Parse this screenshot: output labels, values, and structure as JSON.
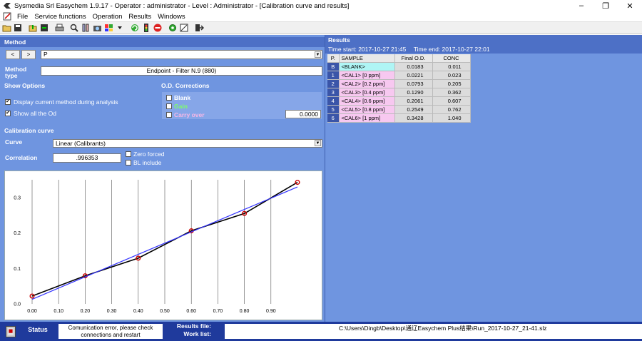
{
  "titlebar": {
    "title": "Sysmedia Srl Easychem 1.9.17 - Operator : administrator - Level : Administrator - [Calibration curve and results]",
    "minimize": "–",
    "maximize": "❐",
    "close": "✕"
  },
  "menubar": {
    "items": [
      "File",
      "Service functions",
      "Operation",
      "Results",
      "Windows"
    ]
  },
  "toolbar": {
    "icons": [
      "open-icon",
      "save-icon",
      "load-icon",
      "export-icon",
      "print-icon",
      "search-icon",
      "chemistry-icon",
      "camera-icon",
      "palette-icon",
      "dropdown-icon",
      "refresh-icon",
      "traffic-light-icon",
      "stop-icon",
      "settings-icon",
      "calibration-icon",
      "exit-icon"
    ]
  },
  "method": {
    "header": "Method",
    "prev": "<",
    "next": ">",
    "value": "P",
    "type_label": "Method type",
    "type_value": "Endpoint - Filter N.9 (880)"
  },
  "show_options": {
    "header": "Show Options",
    "display_current": {
      "label": "Display current method during analysis",
      "checked": true
    },
    "show_all_od": {
      "label": "Show all the Od",
      "checked": true
    }
  },
  "od_corrections": {
    "header": "O.D. Corrections",
    "blank": {
      "label": "Blank",
      "checked": false
    },
    "gain": {
      "label": "Gain",
      "checked": false
    },
    "carry_over": {
      "label": "Carry over",
      "checked": false,
      "value": "0.0000"
    }
  },
  "calibration_curve": {
    "header": "Calibration curve",
    "curve_label": "Curve",
    "curve_value": "Linear (Calibrants)",
    "correlation_label": "Correlation",
    "correlation_value": ".996353",
    "zero_forced": {
      "label": "Zero forced",
      "checked": false
    },
    "bl_include": {
      "label": "BL include",
      "checked": false
    }
  },
  "chart_data": {
    "type": "line",
    "x": [
      0.0,
      0.2,
      0.4,
      0.6,
      0.8,
      1.0
    ],
    "series": [
      {
        "values": [
          0.0221,
          0.0793,
          0.129,
          0.2061,
          0.2549,
          0.3428
        ],
        "color": "#000000",
        "marker_color": "#cc0000"
      },
      {
        "values": [
          0.0129,
          0.0763,
          0.1397,
          0.203,
          0.2664,
          0.3298
        ],
        "color": "#3333ff"
      }
    ],
    "xlim": [
      0.0,
      1.0
    ],
    "ylim": [
      0.0,
      0.35
    ],
    "xticks": [
      "0.00",
      "0.10",
      "0.20",
      "0.30",
      "0.40",
      "0.50",
      "0.60",
      "0.70",
      "0.80",
      "0.90"
    ],
    "yticks": [
      "0.0",
      "0.1",
      "0.2",
      "0.3"
    ],
    "grid": true,
    "title": "",
    "xlabel": "",
    "ylabel": ""
  },
  "results": {
    "header": "Results",
    "time_start_label": "Time start: 2017-10-27 21:45",
    "time_end_label": "Time end: 2017-10-27 22:01",
    "columns": [
      "P.",
      "SAMPLE",
      "Final O.D.",
      "CONC"
    ],
    "rows": [
      {
        "p": "B",
        "sample": "<BLANK>",
        "od": "0.0183",
        "conc": "0.011",
        "color": "#aff5f5"
      },
      {
        "p": "1",
        "sample": "<CAL1> [0 ppm]",
        "od": "0.0221",
        "conc": "0.023",
        "color": "#f7c8f0"
      },
      {
        "p": "2",
        "sample": "<CAL2> [0.2 ppm]",
        "od": "0.0793",
        "conc": "0.205",
        "color": "#f7c8f0"
      },
      {
        "p": "3",
        "sample": "<CAL3> [0.4 ppm]",
        "od": "0.1290",
        "conc": "0.362",
        "color": "#f7c8f0"
      },
      {
        "p": "4",
        "sample": "<CAL4> [0.6 ppm]",
        "od": "0.2061",
        "conc": "0.607",
        "color": "#f7c8f0"
      },
      {
        "p": "5",
        "sample": "<CAL5> [0.8 ppm]",
        "od": "0.2549",
        "conc": "0.762",
        "color": "#f7c8f0"
      },
      {
        "p": "6",
        "sample": "<CAL6> [1 ppm]",
        "od": "0.3428",
        "conc": "1.040",
        "color": "#f7c8f0"
      }
    ]
  },
  "statusbar": {
    "status_label": "Status",
    "message": "Comunication error, please check connections and restart",
    "results_file_label": "Results file:",
    "work_list_label": "Work list:",
    "results_file_path": "C:\\Users\\Dingb\\Desktop\\通辽Easychem Plus结果\\Run_2017-10-27_21-41.slz"
  }
}
